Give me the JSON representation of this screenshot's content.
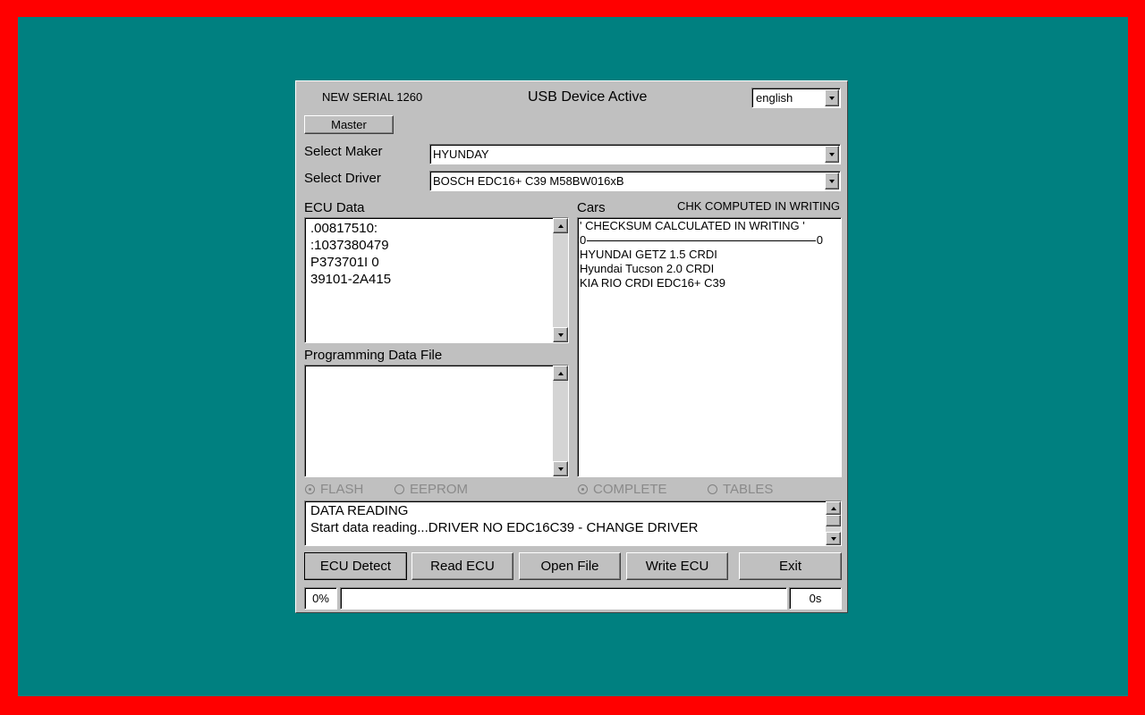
{
  "header": {
    "serial": "NEW SERIAL 1260",
    "status": "USB Device Active",
    "language": "english"
  },
  "master_label": "Master",
  "maker": {
    "label": "Select Maker",
    "value": "HYUNDAY"
  },
  "driver": {
    "label": "Select Driver",
    "value": "BOSCH EDC16+ C39 M58BW016xB"
  },
  "ecu_data": {
    "label": "ECU Data",
    "lines": [
      ".00817510:",
      ":1037380479",
      "P373701I 0",
      "39101-2A415"
    ]
  },
  "programming": {
    "label": "Programming Data File"
  },
  "cars": {
    "label": "Cars",
    "checksum_note": "CHK COMPUTED IN WRITING",
    "title_line": "' CHECKSUM CALCULATED IN WRITING '",
    "range_start": "0",
    "range_end": "0",
    "items": [
      "HYUNDAI GETZ 1.5 CRDI",
      "Hyundai Tucson 2.0 CRDI",
      "KIA RIO CRDI EDC16+ C39"
    ]
  },
  "radios": {
    "flash": "FLASH",
    "eeprom": "EEPROM",
    "complete": "COMPLETE",
    "tables": "TABLES"
  },
  "log": [
    "DATA READING",
    "Start data reading...DRIVER NO EDC16C39 - CHANGE DRIVER"
  ],
  "buttons": {
    "ecu_detect": "ECU Detect",
    "read_ecu": "Read ECU",
    "open_file": "Open File",
    "write_ecu": "Write ECU",
    "exit": "Exit"
  },
  "progress": {
    "percent_label": "0%",
    "percent": 0,
    "time_label": "0s"
  },
  "colors": {
    "frame": "#ff0000",
    "desktop": "#008080",
    "window": "#c0c0c0"
  }
}
